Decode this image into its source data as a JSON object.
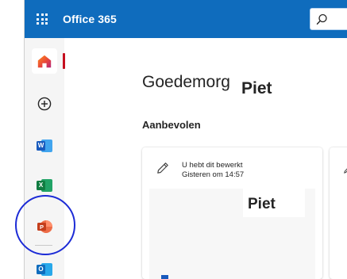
{
  "header": {
    "app_name": "Office 365",
    "waffle_icon": "app-launcher-icon",
    "search_icon": "search-icon",
    "brand_color": "#0f6cbd"
  },
  "rail": {
    "items": [
      {
        "name": "Home",
        "icon": "home-icon",
        "selected": true
      },
      {
        "name": "Create",
        "icon": "add-circle-icon"
      },
      {
        "name": "Word",
        "icon": "word-icon",
        "letter": "W",
        "color": "#185abd"
      },
      {
        "name": "Excel",
        "icon": "excel-icon",
        "letter": "X",
        "color": "#107c41"
      },
      {
        "name": "PowerPoint",
        "icon": "powerpoint-icon",
        "letter": "P",
        "color": "#c43e1c"
      },
      {
        "name": "Outlook",
        "icon": "outlook-icon",
        "letter": "O",
        "color": "#0f6cbd"
      }
    ],
    "highlight_ring_color": "#1c2bd6",
    "selected_indicator_color": "#c50f1f"
  },
  "main": {
    "greeting": "Goedemorg",
    "name_overlay": "Piet",
    "section_title": "Aanbevolen",
    "cards": [
      {
        "icon": "edit-pencil-icon",
        "line1": "U hebt dit bewerkt",
        "line2": "Gisteren om 14:57",
        "preview_overlay": "Piet"
      }
    ]
  }
}
